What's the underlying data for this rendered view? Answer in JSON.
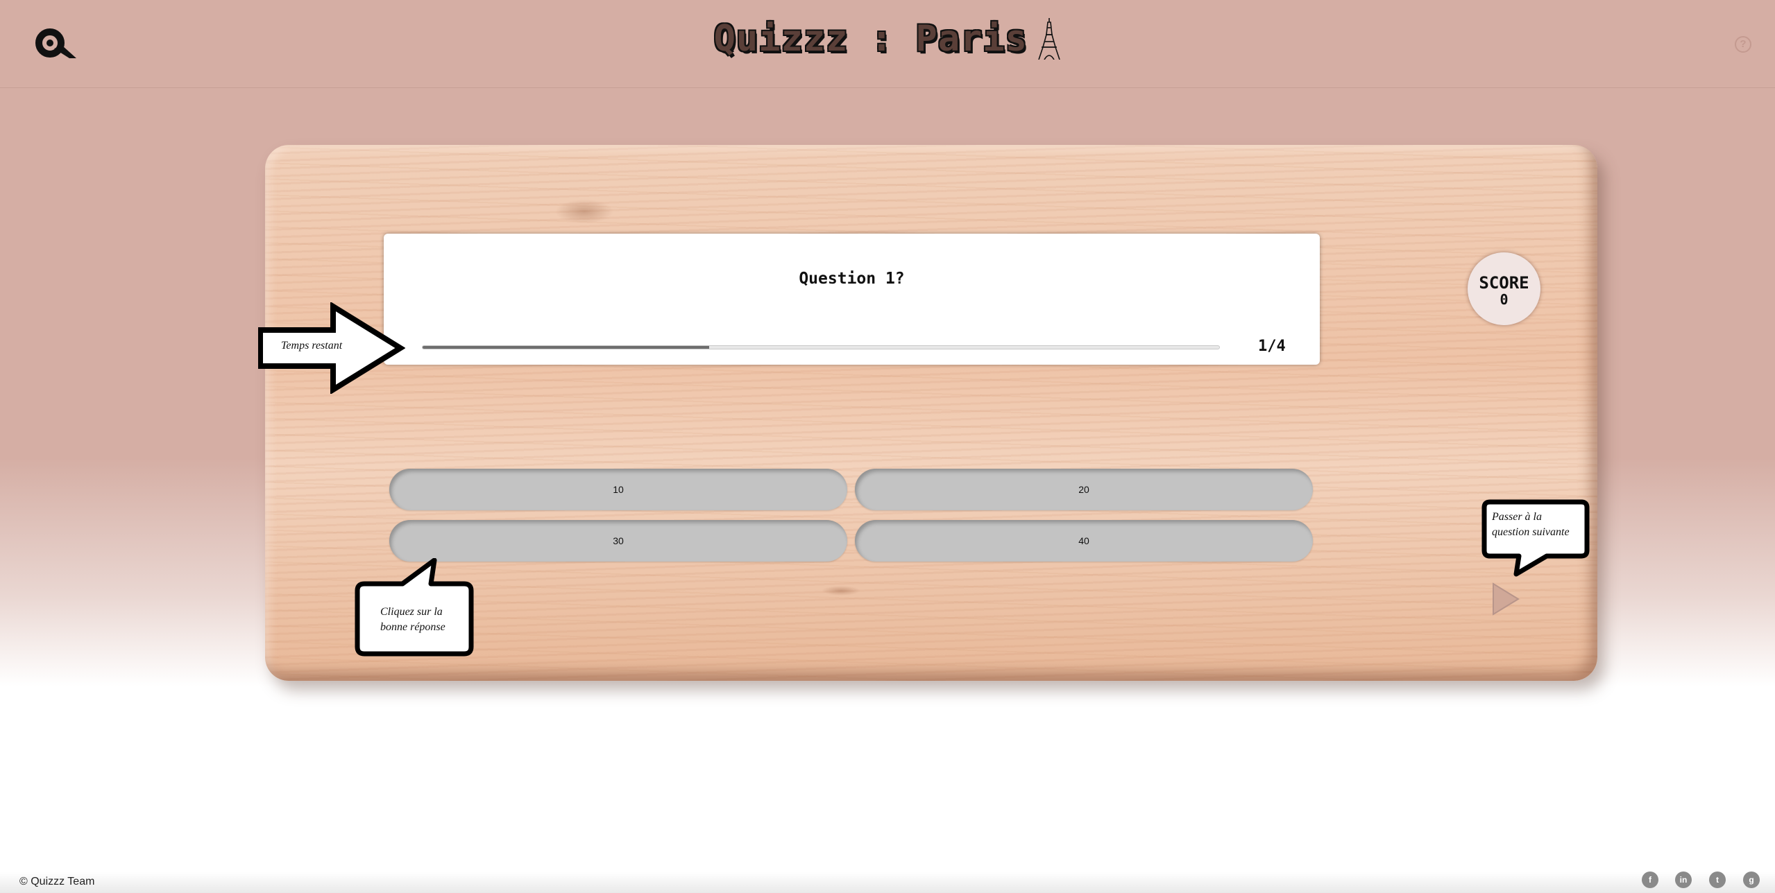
{
  "header": {
    "title": "Quizzz : Paris",
    "logo_icon": "q-logo-icon",
    "eiffel_icon": "eiffel-tower-icon",
    "help_label": "?"
  },
  "question": {
    "text": "Question 1?",
    "counter": "1/4",
    "time_remaining_fraction": 0.36
  },
  "score": {
    "label": "SCORE",
    "value": "0"
  },
  "answers": [
    {
      "label": "10"
    },
    {
      "label": "20"
    },
    {
      "label": "30"
    },
    {
      "label": "40"
    }
  ],
  "hints": {
    "timer": "Temps restant",
    "click_answer": "Cliquez sur la bonne réponse",
    "next_question": "Passer à la question suivante"
  },
  "next_button_icon": "play-arrow-icon",
  "footer": {
    "copyright": "© Quizzz Team",
    "social": [
      {
        "icon": "facebook-icon",
        "glyph": "f"
      },
      {
        "icon": "linkedin-icon",
        "glyph": "in"
      },
      {
        "icon": "twitter-icon",
        "glyph": "t"
      },
      {
        "icon": "github-icon",
        "glyph": "g"
      }
    ]
  },
  "colors": {
    "background": "#d5aea4",
    "answer_button": "#c3c3c3",
    "progress_fill": "#6e6e6e",
    "score_circle": "#f1e5e3"
  }
}
